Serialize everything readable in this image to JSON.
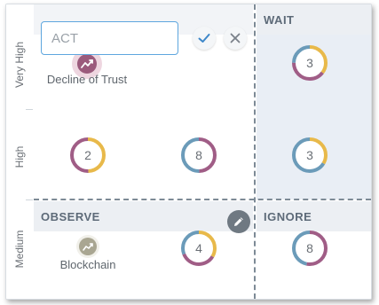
{
  "axis": {
    "y_labels": [
      "Very High",
      "High",
      "Medium"
    ]
  },
  "quadrants": {
    "act": {
      "title": ""
    },
    "wait": {
      "title": "WAIT"
    },
    "observe": {
      "title": "OBSERVE"
    },
    "ignore": {
      "title": "IGNORE"
    }
  },
  "editor": {
    "value": "",
    "placeholder": "ACT",
    "confirm_icon": "check-icon",
    "cancel_icon": "close-icon"
  },
  "trends": [
    {
      "name": "Decline of Trust",
      "icon": "trend-up-icon",
      "color": "#9b5a7c",
      "highlighted": true
    },
    {
      "name": "Blockchain",
      "icon": "trend-up-icon",
      "color": "#a9a692",
      "highlighted": false
    }
  ],
  "nodes": [
    {
      "id": "wait-very-high",
      "count": "3"
    },
    {
      "id": "act-high-1",
      "count": "2"
    },
    {
      "id": "act-high-2",
      "count": "8"
    },
    {
      "id": "wait-high",
      "count": "3"
    },
    {
      "id": "observe-medium",
      "count": "4"
    },
    {
      "id": "ignore-medium",
      "count": "8"
    }
  ],
  "colors": {
    "segment_yellow": "#e8b94a",
    "segment_purple": "#a05d86",
    "segment_blue": "#6b9bb9",
    "divider": "#7d8a96",
    "input_border": "#5ea6de",
    "confirm": "#3d87c9"
  },
  "edit_button_icon": "pencil-icon"
}
